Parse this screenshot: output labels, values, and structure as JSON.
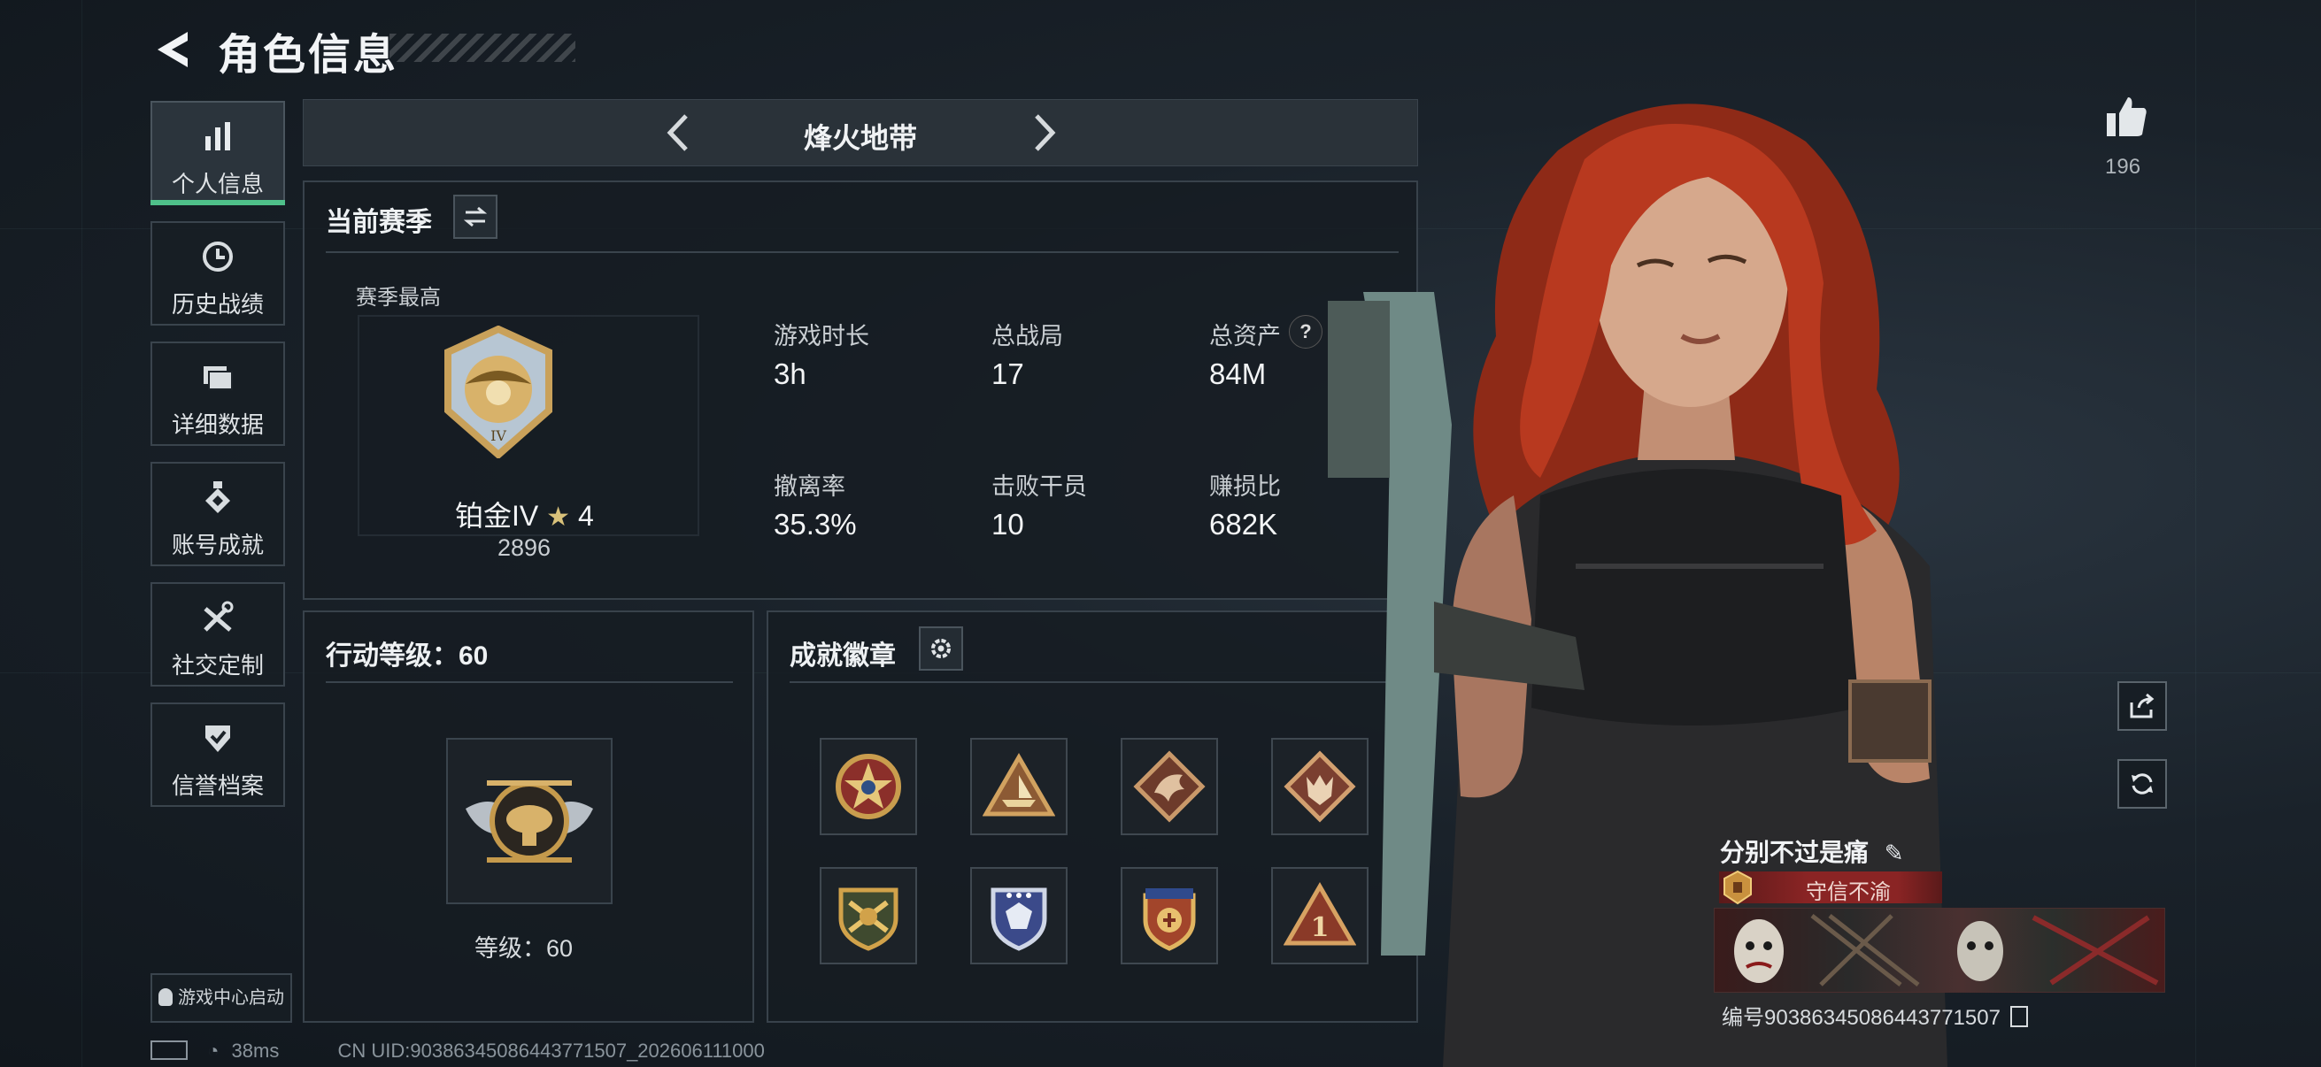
{
  "header": {
    "title": "角色信息"
  },
  "sidebar": {
    "items": [
      {
        "label": "个人信息",
        "icon": "bar-chart-icon",
        "active": true
      },
      {
        "label": "历史战绩",
        "icon": "clock-history-icon"
      },
      {
        "label": "详细数据",
        "icon": "folder-icon"
      },
      {
        "label": "账号成就",
        "icon": "medal-icon"
      },
      {
        "label": "社交定制",
        "icon": "tools-icon"
      },
      {
        "label": "信誉档案",
        "icon": "shield-check-icon"
      }
    ],
    "game_center": "游戏中心启动"
  },
  "mode": {
    "title": "烽火地带"
  },
  "season": {
    "title": "当前赛季",
    "best_label": "赛季最高",
    "rank_name": "铂金IV",
    "stars": "4",
    "score": "2896",
    "stats": [
      {
        "label": "游戏时长",
        "value": "3h"
      },
      {
        "label": "总战局",
        "value": "17"
      },
      {
        "label": "总资产",
        "value": "84M",
        "help": "?"
      },
      {
        "label": "撤离率",
        "value": "35.3%"
      },
      {
        "label": "击败干员",
        "value": "10"
      },
      {
        "label": "赚损比",
        "value": "682K"
      }
    ]
  },
  "level": {
    "title": "行动等级：60",
    "level_text": "等级：60"
  },
  "achievements": {
    "title": "成就徽章",
    "badges": [
      "badge-star-wreath",
      "badge-ship-triangle",
      "badge-dragon-diamond",
      "badge-wolf-diamond",
      "badge-crossed-shield",
      "badge-blue-shield",
      "badge-emblem-stars",
      "badge-number-one"
    ]
  },
  "profile": {
    "likes": "196",
    "name": "分别不过是痛",
    "title_tag": "守信不渝",
    "uid": "编号903863450864437715​07"
  },
  "status": {
    "latency": "38ms",
    "uid_line": "CN UID:903863450864437715​07_202606111000"
  },
  "colors": {
    "accent": "#4fc08a",
    "ribbon": "#8a2424"
  }
}
